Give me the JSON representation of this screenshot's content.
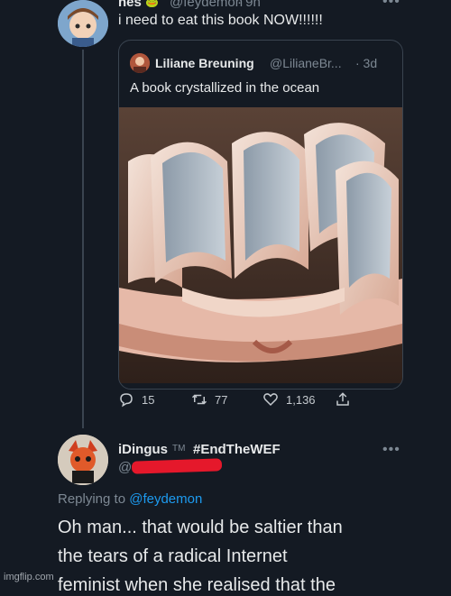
{
  "tweet1": {
    "name": "nes",
    "handle": "@feydemon",
    "time": "· 9h",
    "text": "i need to eat this book NOW!!!!!!",
    "more": "•••"
  },
  "quote": {
    "name": "Liliane Breuning",
    "handle": "@LilianeBr...",
    "time": "· 3d",
    "text": "A book crystallized in the ocean"
  },
  "actions": {
    "replies": "15",
    "retweets": "77",
    "likes": "1,136"
  },
  "reply": {
    "name": "iDingus",
    "tm": "TM",
    "hashtag": "#EndTheWEF",
    "handle": "@D",
    "more": "•••",
    "replying_prefix": "Replying to",
    "replying_to": "@feydemon",
    "line1": "Oh man... that would be saltier than",
    "line2": "the tears of a radical Internet",
    "line3": "feminist when she realised that the"
  },
  "watermark": "imgflip.com",
  "colors": {
    "background": "#141a23",
    "link": "#1d9bf0",
    "redaction": "#e5182b"
  }
}
